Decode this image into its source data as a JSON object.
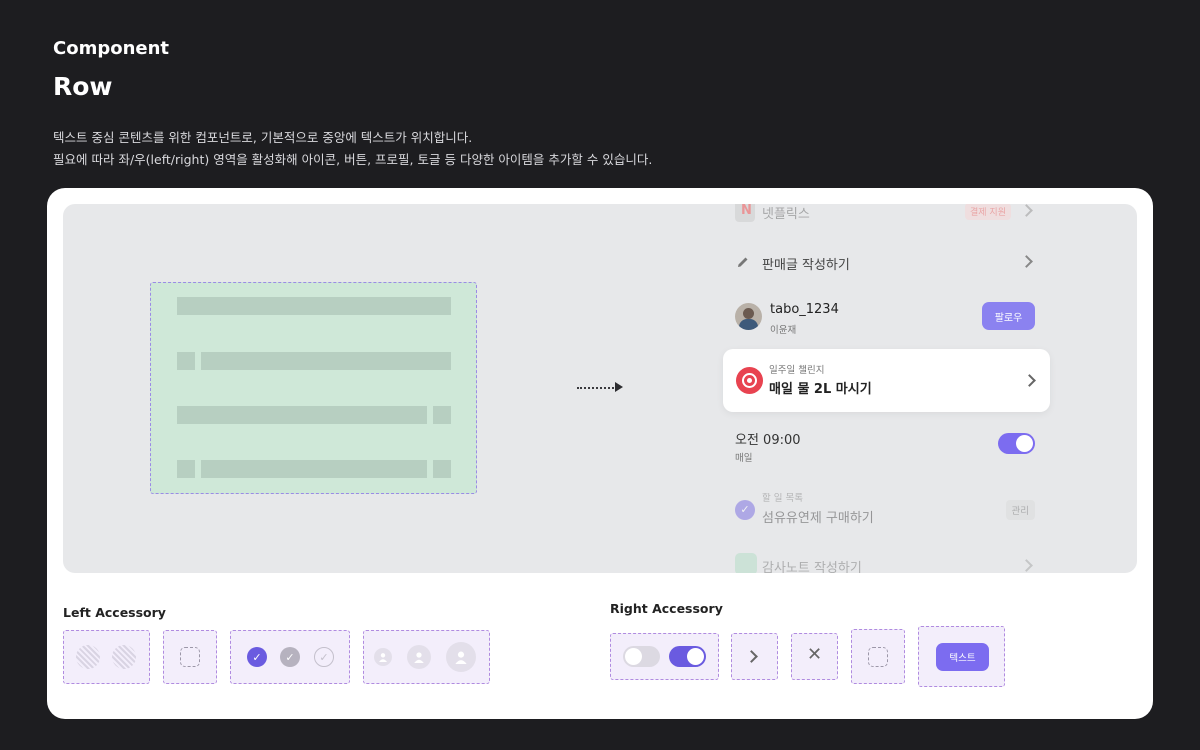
{
  "header": {
    "eyebrow": "Component",
    "title": "Row",
    "desc_line1": "텍스트 중심 콘텐츠를 위한 컴포넌트로, 기본적으로 중앙에 텍스트가 위치합니다.",
    "desc_line2": "필요에 따라  좌/우(left/right) 영역을 활성화해 아이콘, 버튼, 프로필, 토글 등 다양한 아이템을 추가할 수 있습니다."
  },
  "preview_list": {
    "netflix": {
      "label": "넷플릭스",
      "badge": "결제 지원"
    },
    "write": {
      "label": "판매글 작성하기"
    },
    "profile": {
      "name": "tabo_1234",
      "real_name": "이윤재",
      "button": "팔로우"
    },
    "challenge": {
      "caption": "일주일 챌린지",
      "label": "매일 물 2L 마시기"
    },
    "alarm": {
      "time": "오전 09:00",
      "repeat": "매일",
      "toggle_on": true
    },
    "todo": {
      "caption": "할 일 목록",
      "label": "섬유유연제 구매하기",
      "button": "관리"
    },
    "gratitude": {
      "label": "감사노트 작성하기"
    }
  },
  "accessories": {
    "left_title": "Left Accessory",
    "right_title": "Right Accessory",
    "right_text_button": "텍스트"
  },
  "colors": {
    "accent": "#7c6cf0",
    "schematic_fill": "#cfe8d8",
    "card_bg": "#ffffff",
    "page_bg": "#1d1d20"
  }
}
